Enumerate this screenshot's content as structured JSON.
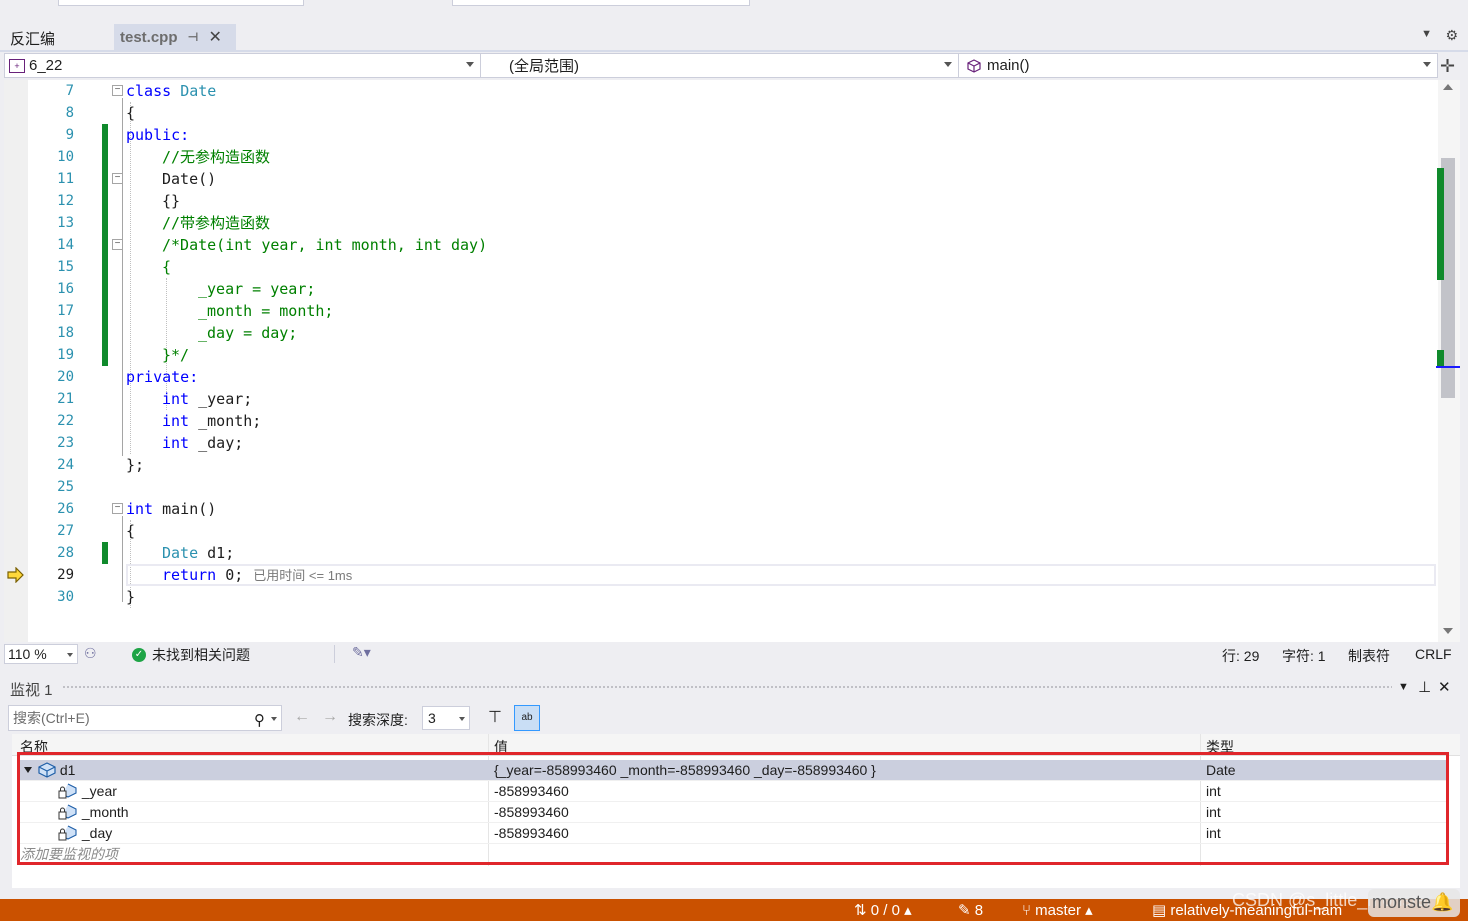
{
  "tabs": {
    "disassembly": "反汇编",
    "active_file": "test.cpp",
    "active_pin_icon": "pin-icon",
    "close_icon": "close-icon"
  },
  "navbar": {
    "project": "6_22",
    "scope": "(全局范围)",
    "member": "main()"
  },
  "editor": {
    "current_line": 29,
    "exec_hint": "已用时间 <= 1ms",
    "lines": [
      {
        "n": "7"
      },
      {
        "n": "8"
      },
      {
        "n": "9"
      },
      {
        "n": "10"
      },
      {
        "n": "11"
      },
      {
        "n": "12"
      },
      {
        "n": "13"
      },
      {
        "n": "14"
      },
      {
        "n": "15"
      },
      {
        "n": "16"
      },
      {
        "n": "17"
      },
      {
        "n": "18"
      },
      {
        "n": "19"
      },
      {
        "n": "20"
      },
      {
        "n": "21"
      },
      {
        "n": "22"
      },
      {
        "n": "23"
      },
      {
        "n": "24"
      },
      {
        "n": "25"
      },
      {
        "n": "26"
      },
      {
        "n": "27"
      },
      {
        "n": "28"
      },
      {
        "n": "29"
      },
      {
        "n": "30"
      }
    ],
    "code": {
      "l7_kw": "class",
      "l7_ty": "Date",
      "l8": "{",
      "l9": "public:",
      "l10": "//无参构造函数",
      "l11": "Date()",
      "l12": "{}",
      "l13": "//带参构造函数",
      "l14": "/*Date(int year, int month, int day)",
      "l15": "{",
      "l16": "_year = year;",
      "l17": "_month = month;",
      "l18": "_day = day;",
      "l19": "}*/",
      "l20": "private:",
      "l21_kw": "int",
      "l21_rest": " _year;",
      "l22_kw": "int",
      "l22_rest": " _month;",
      "l23_kw": "int",
      "l23_rest": " _day;",
      "l24": "};",
      "l26_kw": "int",
      "l26_rest": " main()",
      "l27": "{",
      "l28_ty": "Date",
      "l28_rest": " d1;",
      "l29_kw": "return",
      "l29_rest": " 0;",
      "l30": "}"
    }
  },
  "editor_status": {
    "zoom": "110 %",
    "issues": "未找到相关问题",
    "line": "行: 29",
    "char": "字符: 1",
    "tabs": "制表符",
    "eol": "CRLF"
  },
  "watch": {
    "title": "监视 1",
    "search_placeholder": "搜索(Ctrl+E)",
    "depth_label": "搜索深度:",
    "depth_value": "3",
    "columns": {
      "name": "名称",
      "value": "值",
      "type": "类型"
    },
    "rows": [
      {
        "name": "d1",
        "value": "{_year=-858993460 _month=-858993460 _day=-858993460 }",
        "type": "Date"
      },
      {
        "name": "_year",
        "value": "-858993460",
        "type": "int"
      },
      {
        "name": "_month",
        "value": "-858993460",
        "type": "int"
      },
      {
        "name": "_day",
        "value": "-858993460",
        "type": "int"
      }
    ],
    "add_item": "添加要监视的项"
  },
  "statusbar": {
    "sync": "0 / 0",
    "edits": "8",
    "branch": "master",
    "repo": "relatively-meaningful-nam",
    "watermark": "CSDN @s_little_monster_"
  },
  "colors": {
    "accent_status": "#ca5100",
    "change_bar": "#108a2c",
    "keyword": "#0000ff",
    "type": "#2b91af",
    "comment": "#008000",
    "highlight_box": "#e0262b"
  }
}
